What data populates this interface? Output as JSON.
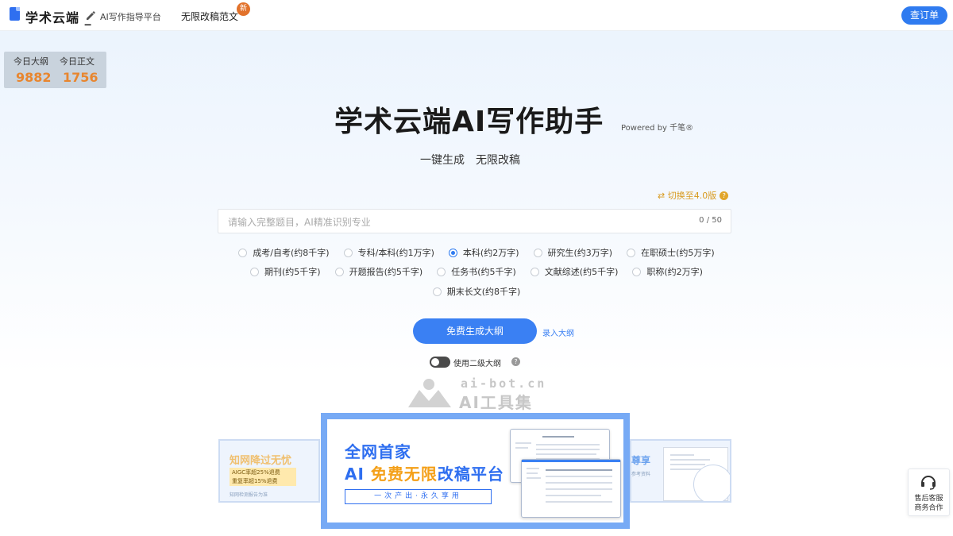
{
  "header": {
    "brand": "学术云端",
    "brand_suffix": "_",
    "subtitle": "AI写作指导平台",
    "nav_link": "无限改稿范文",
    "new_badge": "新",
    "order_button": "查订单"
  },
  "stats": {
    "outline_label": "今日大纲",
    "outline_value": "9882",
    "text_label": "今日正文",
    "text_value": "1756"
  },
  "hero": {
    "title": "学术云端AI写作助手",
    "powered": "Powered by 千笔®",
    "subtitle": "一键生成　无限改稿"
  },
  "version_switch": {
    "label": "⇄ 切换至4.0版",
    "help": "?"
  },
  "topic_input": {
    "placeholder": "请输入完整题目，AI精准识别专业",
    "value": "",
    "counter": "0 / 50"
  },
  "options": {
    "row1": [
      {
        "label": "成考/自考(约8千字)",
        "selected": false
      },
      {
        "label": "专科/本科(约1万字)",
        "selected": false
      },
      {
        "label": "本科(约2万字)",
        "selected": true
      },
      {
        "label": "研究生(约3万字)",
        "selected": false
      },
      {
        "label": "在职硕士(约5万字)",
        "selected": false
      }
    ],
    "row2": [
      {
        "label": "期刊(约5千字)",
        "selected": false
      },
      {
        "label": "开题报告(约5千字)",
        "selected": false
      },
      {
        "label": "任务书(约5千字)",
        "selected": false
      },
      {
        "label": "文献综述(约5千字)",
        "selected": false
      },
      {
        "label": "职称(约2万字)",
        "selected": false
      }
    ],
    "row3": [
      {
        "label": "期末长文(约8千字)",
        "selected": false
      }
    ]
  },
  "actions": {
    "generate_button": "免费生成大纲",
    "import_link": "录入大纲",
    "toggle_label": "使用二级大纲",
    "toggle_help": "?"
  },
  "watermark": {
    "url": "ai-bot.cn",
    "name": "AI工具集"
  },
  "banners": {
    "main_line1": "全网首家",
    "main_line2_prefix": "AI ",
    "main_line2_highlight": "免费无限",
    "main_line2_suffix": "改稿平台",
    "main_tag": "一次产出·永久享用",
    "left_title": "知网降过无忧",
    "left_tag_line1": "AIGC率超25%退费",
    "left_tag_line2": "重复率超15%退费",
    "left_footer": "知网检测报告为准",
    "right_title": "尊享",
    "right_sub": "参考资料"
  },
  "support": {
    "label1": "售后客服",
    "label2": "商务合作"
  },
  "colors": {
    "primary": "#3a80f3",
    "accent_orange": "#e8862f",
    "version_gold": "#d89a1f"
  }
}
